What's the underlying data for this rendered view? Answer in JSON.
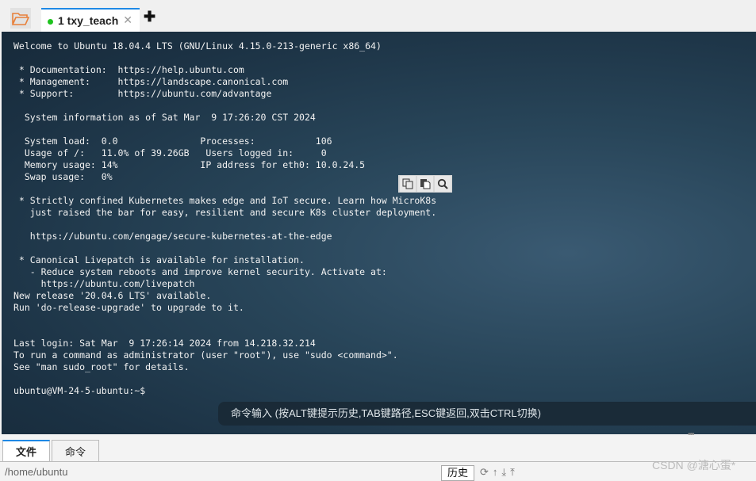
{
  "tabs": [
    {
      "label": "1 txy_teach",
      "status_color": "#1ec31e",
      "active": true
    }
  ],
  "accent_color": "#1e88e5",
  "terminal": {
    "lines": [
      "Welcome to Ubuntu 18.04.4 LTS (GNU/Linux 4.15.0-213-generic x86_64)",
      "",
      " * Documentation:  https://help.ubuntu.com",
      " * Management:     https://landscape.canonical.com",
      " * Support:        https://ubuntu.com/advantage",
      "",
      "  System information as of Sat Mar  9 17:26:20 CST 2024",
      "",
      "  System load:  0.0               Processes:           106",
      "  Usage of /:   11.0% of 39.26GB   Users logged in:     0",
      "  Memory usage: 14%               IP address for eth0: 10.0.24.5",
      "  Swap usage:   0%",
      "",
      " * Strictly confined Kubernetes makes edge and IoT secure. Learn how MicroK8s",
      "   just raised the bar for easy, resilient and secure K8s cluster deployment.",
      "",
      "   https://ubuntu.com/engage/secure-kubernetes-at-the-edge",
      "",
      " * Canonical Livepatch is available for installation.",
      "   - Reduce system reboots and improve kernel security. Activate at:",
      "     https://ubuntu.com/livepatch",
      "New release '20.04.6 LTS' available.",
      "Run 'do-release-upgrade' to upgrade to it.",
      "",
      "",
      "Last login: Sat Mar  9 17:26:14 2024 from 14.218.32.214",
      "To run a command as administrator (user \"root\"), use \"sudo <command>\".",
      "See \"man sudo_root\" for details.",
      "",
      "ubuntu@VM-24-5-ubuntu:~$ "
    ],
    "command_hint": "命令输入 (按ALT键提示历史,TAB键路径,ESC键返回,双击CTRL切换)"
  },
  "bottom_tabs": [
    {
      "label": "文件",
      "active": true
    },
    {
      "label": "命令",
      "active": false
    }
  ],
  "file_path": "/home/ubuntu",
  "history_button": "历史",
  "watermark": "CSDN @溏心蛋*"
}
